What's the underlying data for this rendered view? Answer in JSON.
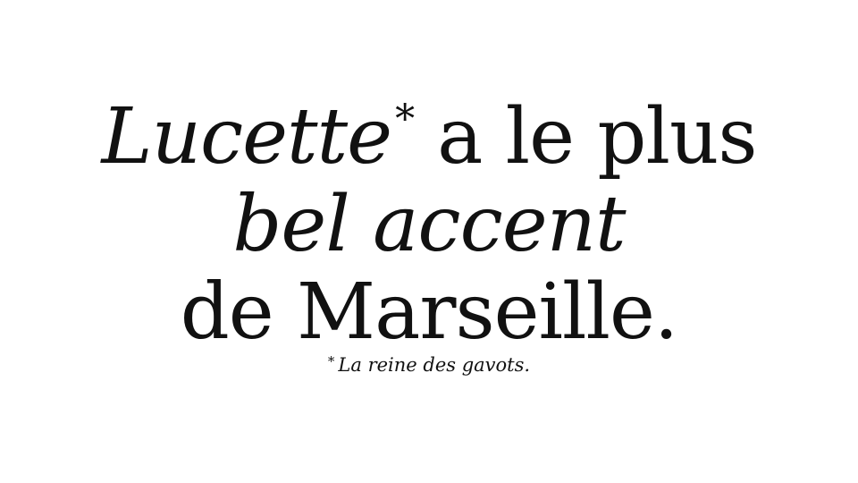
{
  "headline": {
    "line1_italic": "Lucette",
    "asterisk": "*",
    "line1_rest": "a le plus",
    "line2_italic": "bel accent",
    "line3": "de Marseille."
  },
  "footnote": {
    "mark": "*",
    "text": "La reine des gavots."
  },
  "colors": {
    "background": "#ffffff",
    "text": "#111111"
  }
}
